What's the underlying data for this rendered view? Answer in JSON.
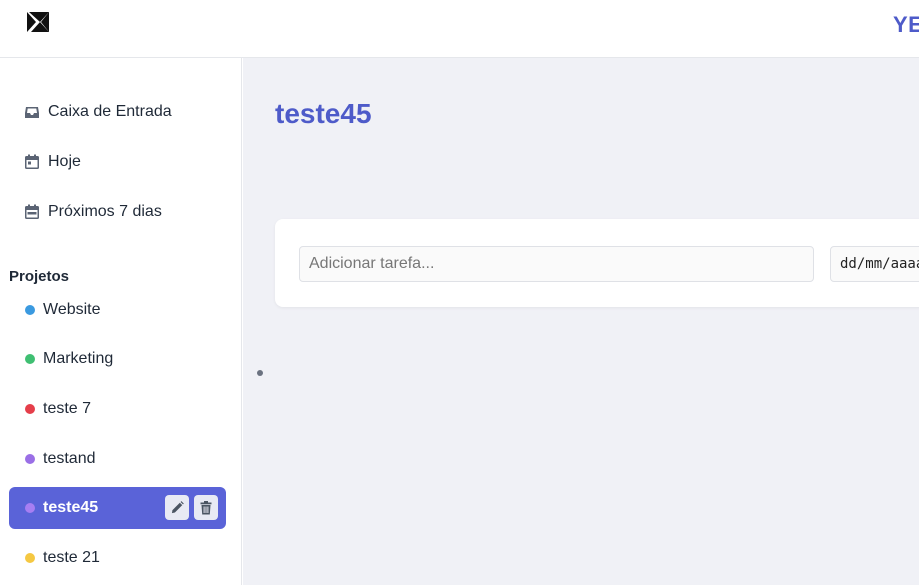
{
  "header": {
    "brand": "YE"
  },
  "sidebar": {
    "nav": [
      {
        "label": "Caixa de Entrada",
        "icon": "inbox-icon"
      },
      {
        "label": "Hoje",
        "icon": "calendar-day-icon"
      },
      {
        "label": "Próximos 7 dias",
        "icon": "calendar-week-icon"
      }
    ],
    "projects_title": "Projetos",
    "projects": [
      {
        "label": "Website",
        "color": "#3b9ae0"
      },
      {
        "label": "Marketing",
        "color": "#3fbf72"
      },
      {
        "label": "teste 7",
        "color": "#e53e4a"
      },
      {
        "label": "testand",
        "color": "#9a6fe6"
      },
      {
        "label": "teste45",
        "color": "#a77ef2",
        "active": true
      },
      {
        "label": "teste 21",
        "color": "#f5c842"
      }
    ]
  },
  "main": {
    "title": "teste45",
    "task": {
      "placeholder": "Adicionar tarefa...",
      "date_value": "dd/mm/aaaa"
    }
  },
  "colors": {
    "accent": "#4e5bc9",
    "active_bg": "#5a63d8"
  }
}
